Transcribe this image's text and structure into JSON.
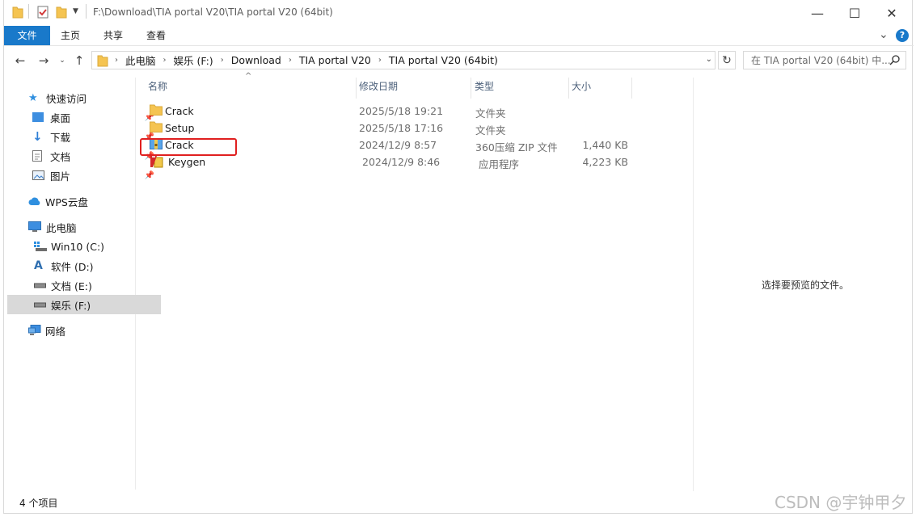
{
  "window": {
    "title_path": "F:\\Download\\TIA portal V20\\TIA portal V20 (64bit)",
    "minimize_glyph": "—",
    "maximize_glyph": "☐",
    "close_glyph": "✕"
  },
  "ribbon": {
    "tabs": [
      "文件",
      "主页",
      "共享",
      "查看"
    ],
    "expand_glyph": "⌄",
    "help_glyph": "?"
  },
  "address": {
    "crumbs": [
      "此电脑",
      "娱乐 (F:)",
      "Download",
      "TIA portal V20",
      "TIA portal V20 (64bit)"
    ],
    "separator": "›",
    "search_placeholder": "在 TIA portal V20 (64bit) 中..."
  },
  "nav": {
    "items": [
      {
        "label": "快速访问",
        "icon": "star-icon",
        "pinned": false
      },
      {
        "label": "桌面",
        "icon": "desktop-folder-icon",
        "pinned": true
      },
      {
        "label": "下载",
        "icon": "download-arrow-icon",
        "pinned": true
      },
      {
        "label": "文档",
        "icon": "document-icon",
        "pinned": true
      },
      {
        "label": "图片",
        "icon": "picture-icon",
        "pinned": true
      },
      {
        "label": "WPS云盘",
        "icon": "cloud-icon",
        "pinned": false
      },
      {
        "label": "此电脑",
        "icon": "computer-icon",
        "pinned": false
      },
      {
        "label": "Win10 (C:)",
        "icon": "system-drive-icon",
        "pinned": false
      },
      {
        "label": "软件 (D:)",
        "icon": "drive-d-icon",
        "pinned": false
      },
      {
        "label": "文档 (E:)",
        "icon": "drive-icon",
        "pinned": false
      },
      {
        "label": "娱乐 (F:)",
        "icon": "drive-icon",
        "pinned": false,
        "selected": true
      },
      {
        "label": "网络",
        "icon": "network-icon",
        "pinned": false
      }
    ]
  },
  "list": {
    "sort_glyph": "^",
    "columns": {
      "name": "名称",
      "date": "修改日期",
      "type": "类型",
      "size": "大小"
    },
    "files": [
      {
        "name": "Crack",
        "date": "2025/5/18 19:21",
        "type": "文件夹",
        "size": "",
        "icon": "folder-icon"
      },
      {
        "name": "Setup",
        "date": "2025/5/18 17:16",
        "type": "文件夹",
        "size": "",
        "icon": "folder-icon"
      },
      {
        "name": "Crack",
        "date": "2024/12/9 8:57",
        "type": "360压缩 ZIP 文件",
        "size": "1,440 KB",
        "icon": "zip-archive-icon"
      },
      {
        "name": "Keygen",
        "date": "2024/12/9 8:46",
        "type": "应用程序",
        "size": "4,223 KB",
        "icon": "keygen-app-icon"
      }
    ]
  },
  "preview": {
    "message": "选择要预览的文件。"
  },
  "status": {
    "item_count": "4 个项目"
  },
  "watermark": "CSDN @宇钟甲夕",
  "colors": {
    "accent": "#1979ca",
    "highlight_box": "#e02020",
    "folder": "#f5c451",
    "selected_nav": "#d9d9d9"
  }
}
